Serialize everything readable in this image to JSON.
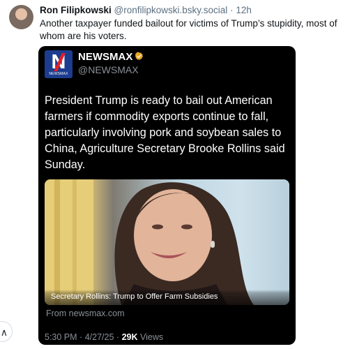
{
  "post": {
    "author_name": "Ron Filipkowski",
    "author_handle": "@ronfilipkowski.bsky.social",
    "separator": "·",
    "age": "12h",
    "text": "Another taxpayer funded bailout for victims of Trump’s stupidity, most of whom are his voters."
  },
  "embed": {
    "logo_letter": "N",
    "logo_word": "NEWSMAX",
    "account_name": "NEWSMAX",
    "account_handle": "@NEWSMAX",
    "verified_color": "#e8a825",
    "text": "President Trump is ready to bail out American farmers if commodity exports continue to fall, particularly involving pork and soybean sales to China, Agriculture Secretary Brooke Rollins said Sunday.",
    "image_caption": "Secretary Rollins: Trump to Offer Farm Subsidies",
    "source": "From newsmax.com",
    "time": "5:30 PM",
    "separator": "·",
    "date": "4/27/25",
    "separator2": "·",
    "views_count": "29K",
    "views_label": "Views"
  },
  "colors": {
    "logo_background": "#1c3d8f",
    "logo_accent": "#e41e26",
    "embed_background": "#000000"
  },
  "controls": {
    "scroll_top_icon": "chevron-up-icon"
  }
}
